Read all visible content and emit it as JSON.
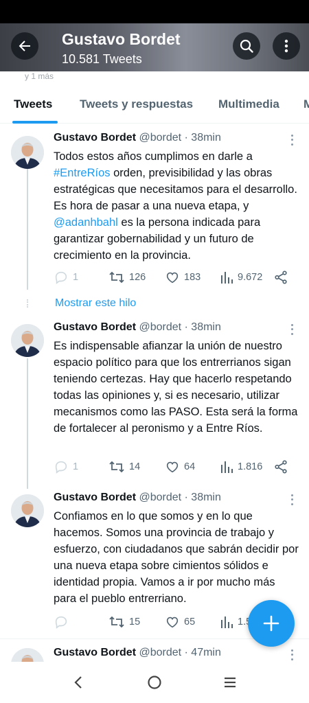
{
  "header": {
    "title": "Gustavo Bordet",
    "tweet_count": "10.581 Tweets",
    "peek_text": "y 1 más"
  },
  "tabs": [
    {
      "label": "Tweets",
      "active": true
    },
    {
      "label": "Tweets y respuestas",
      "active": false
    },
    {
      "label": "Multimedia",
      "active": false
    },
    {
      "label": "M",
      "active": false
    }
  ],
  "show_thread": "Mostrar este hilo",
  "tweets": [
    {
      "name": "Gustavo Bordet",
      "meta": "@bordet · 38min",
      "text": [
        {
          "t": "Todos estos años cumplimos en darle a "
        },
        {
          "t": "#EntreRíos",
          "link": true
        },
        {
          "t": " orden, previsibilidad y las obras estratégicas que necesitamos para el desarrollo. Es hora de pasar a una nueva etapa, y "
        },
        {
          "t": "@adanhbahl",
          "link": true
        },
        {
          "t": " es la persona indicada para garantizar gobernabilidad y un futuro de crecimiento en la provincia."
        }
      ],
      "replies": "1",
      "retweets": "126",
      "likes": "183",
      "views": "9.672"
    },
    {
      "name": "Gustavo Bordet",
      "meta": "@bordet · 38min",
      "text": [
        {
          "t": "Es indispensable afianzar la unión de nuestro espacio político para que los entrerrianos sigan teniendo certezas. Hay que hacerlo respetando todas las opiniones y, si es necesario, utilizar mecanismos como las PASO. Esta será la forma de fortalecer al peronismo y a Entre Ríos."
        }
      ],
      "replies": "1",
      "retweets": "14",
      "likes": "64",
      "views": "1.816"
    },
    {
      "name": "Gustavo Bordet",
      "meta": "@bordet · 38min",
      "text": [
        {
          "t": "Confiamos en lo que somos y en lo que hacemos. Somos una provincia de trabajo y esfuerzo, con ciudadanos que sabrán decidir por una nueva etapa sobre cimientos sólidos e identidad propia. Vamos a ir por mucho más para el pueblo entrerriano."
        }
      ],
      "replies": "",
      "retweets": "15",
      "likes": "65",
      "views": "1.5"
    },
    {
      "name": "Gustavo Bordet",
      "meta": "@bordet · 47min",
      "text": [],
      "replies": "",
      "retweets": "",
      "likes": "",
      "views": ""
    }
  ],
  "icons": {
    "back": "arrow-left-icon",
    "search": "search-icon",
    "more": "more-vertical-icon",
    "reply": "reply-icon",
    "retweet": "retweet-icon",
    "like": "heart-icon",
    "views": "views-icon",
    "share": "share-icon",
    "compose": "plus-icon",
    "nav_back": "chevron-left-icon",
    "nav_home": "circle-home-icon",
    "nav_recents": "menu-lines-icon"
  },
  "colors": {
    "accent": "#1d9bf0",
    "text": "#0f1419",
    "muted": "#536471"
  }
}
